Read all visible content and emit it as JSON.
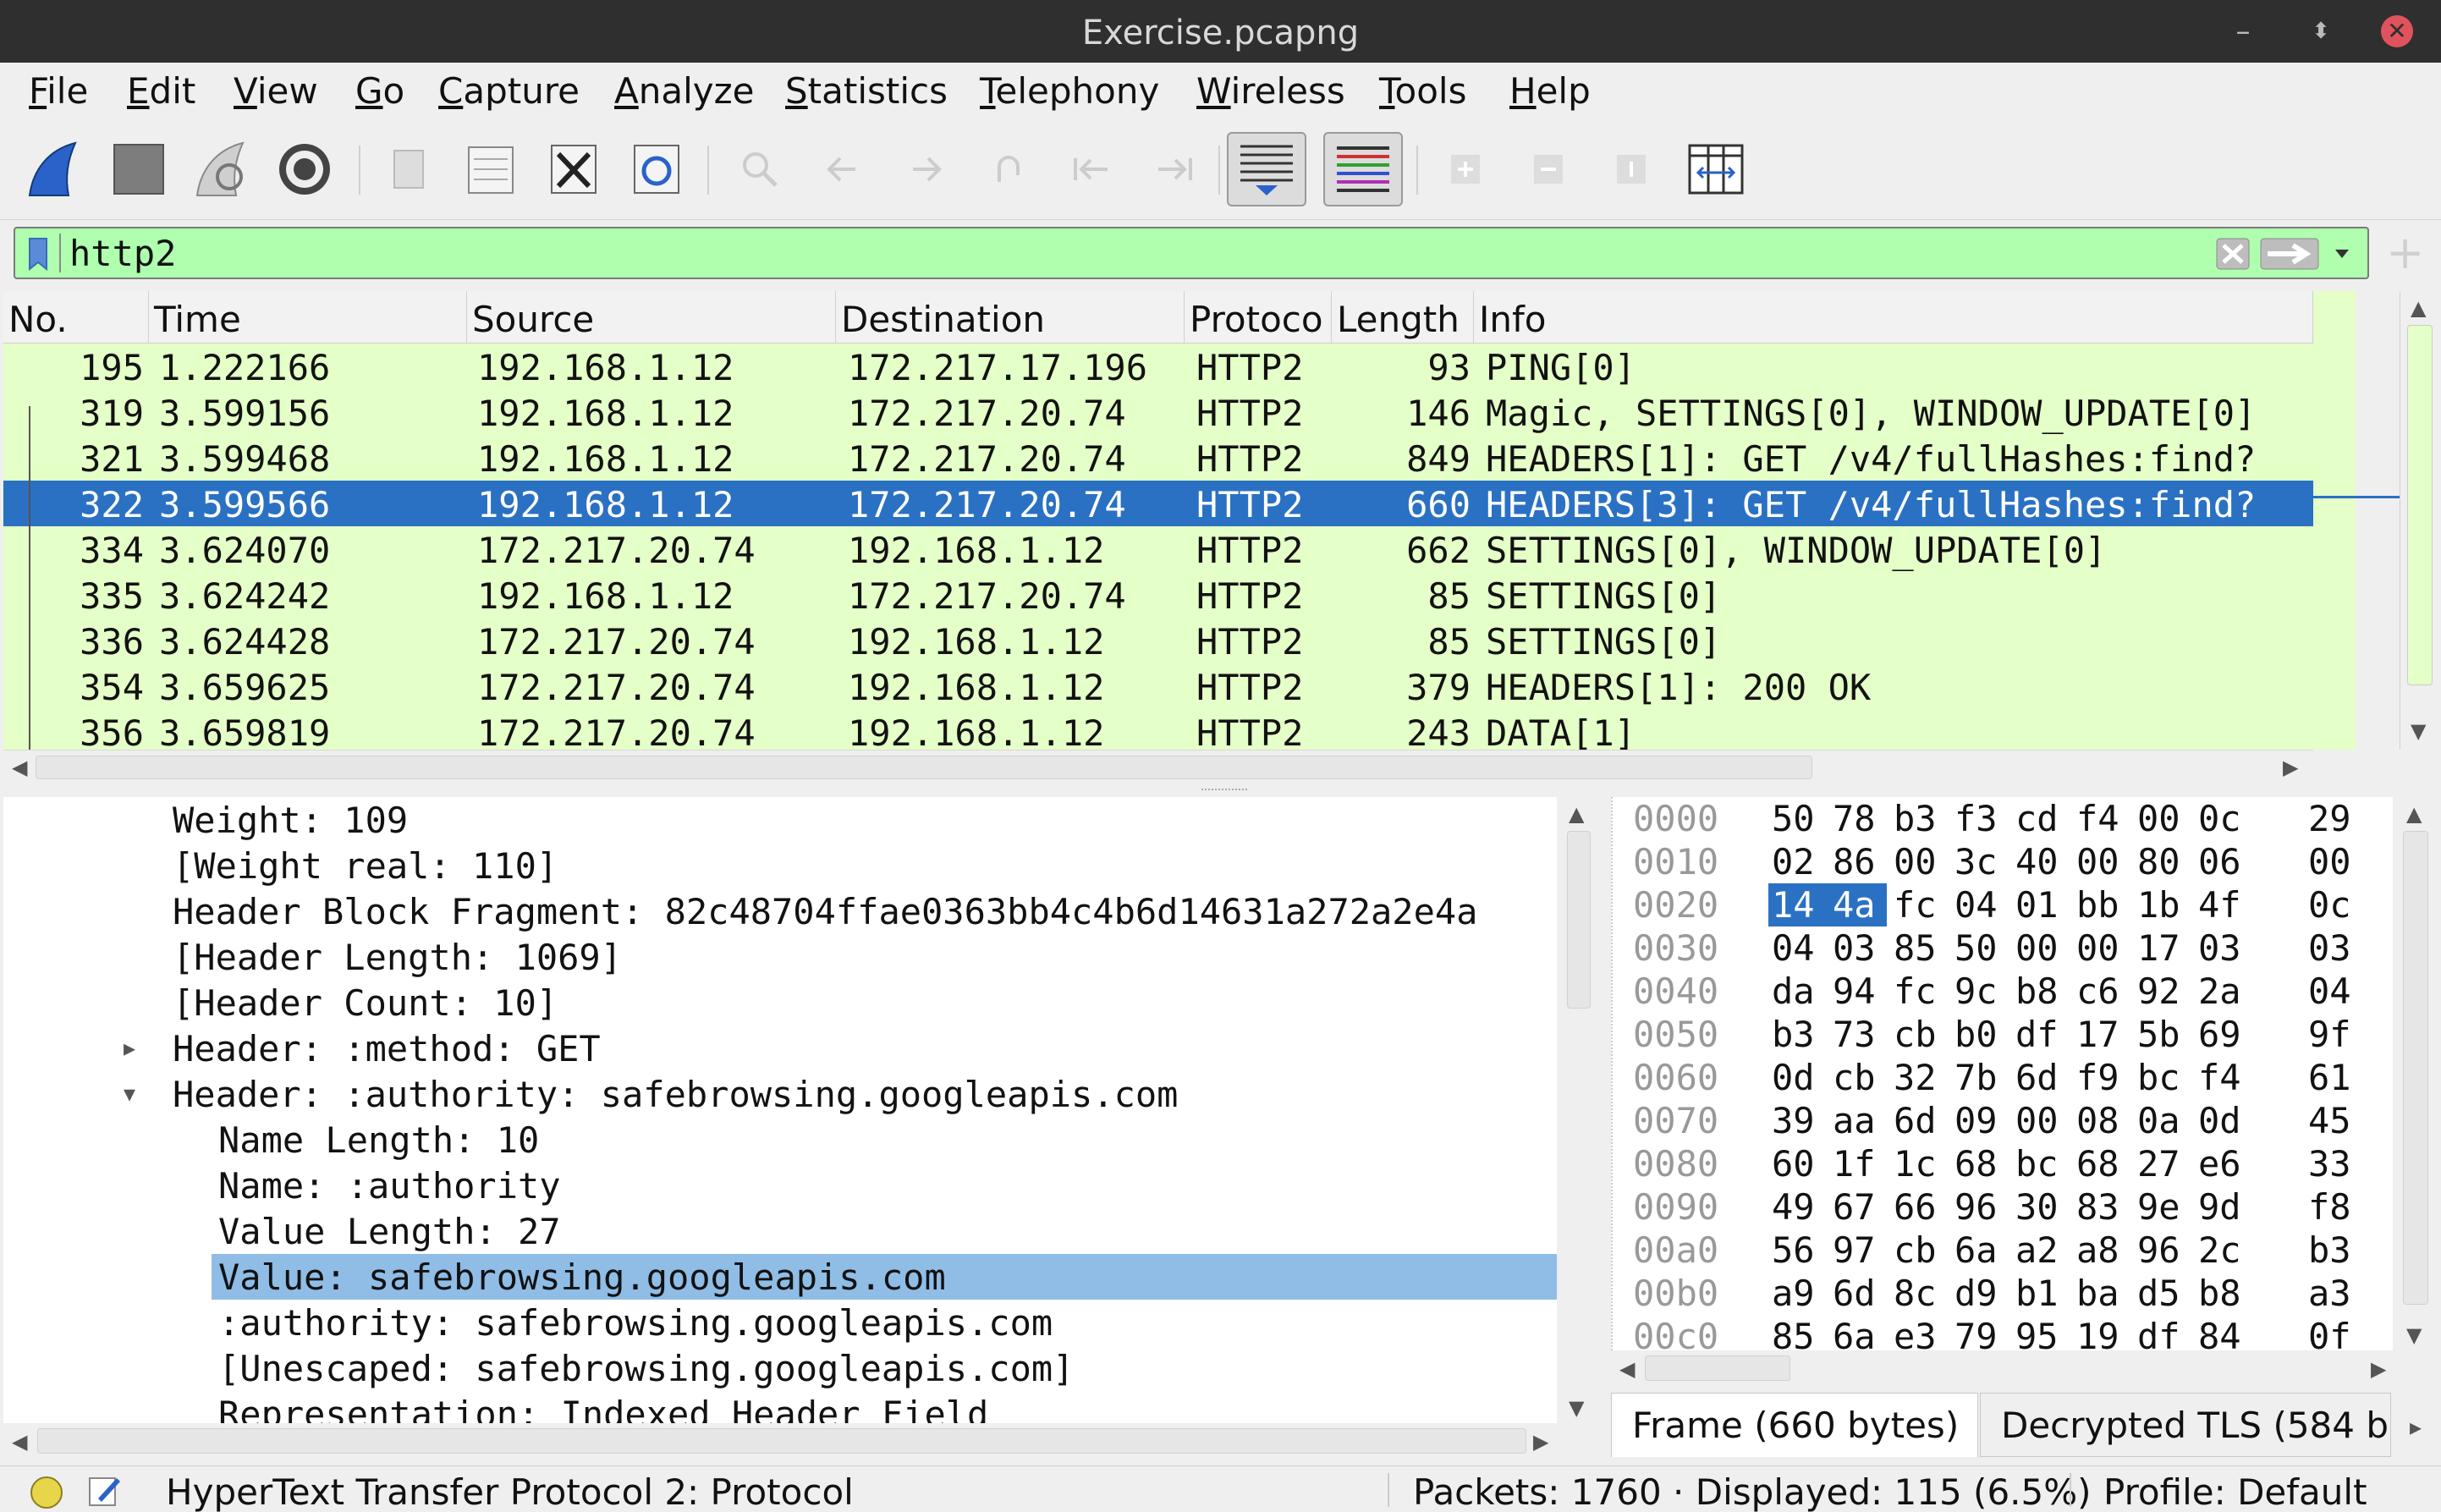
{
  "window": {
    "title": "Exercise.pcapng",
    "close_label": "✕",
    "minimize_label": "–",
    "restore_label": "⬍"
  },
  "menu": [
    "File",
    "Edit",
    "View",
    "Go",
    "Capture",
    "Analyze",
    "Statistics",
    "Telephony",
    "Wireless",
    "Tools",
    "Help"
  ],
  "menu_underline": [
    "F",
    "E",
    "V",
    "G",
    "C",
    "A",
    "S",
    "T",
    "W",
    "T",
    "H"
  ],
  "toolbar": {
    "icons": [
      "shark-fin-start-capture-icon",
      "stop-capture-icon",
      "restart-capture-icon",
      "capture-options-gear-icon",
      "open-file-icon",
      "save-file-icon",
      "close-file-icon",
      "reload-file-icon",
      "find-packet-icon",
      "go-back-icon",
      "go-forward-icon",
      "go-to-packet-icon",
      "go-first-icon",
      "go-last-icon",
      "autoscroll-icon",
      "colorize-icon",
      "zoom-in-icon",
      "zoom-out-icon",
      "normal-size-icon",
      "resize-columns-icon"
    ]
  },
  "filter": {
    "value": "http2"
  },
  "packet_list": {
    "columns": [
      "No.",
      "Time",
      "Source",
      "Destination",
      "Protoco",
      "Length",
      "Info"
    ],
    "rows": [
      {
        "no": "195",
        "time": "1.222166",
        "src": "192.168.1.12",
        "dst": "172.217.17.196",
        "proto": "HTTP2",
        "len": "93",
        "info": "PING[0]"
      },
      {
        "no": "319",
        "time": "3.599156",
        "src": "192.168.1.12",
        "dst": "172.217.20.74",
        "proto": "HTTP2",
        "len": "146",
        "info": "Magic, SETTINGS[0], WINDOW_UPDATE[0]"
      },
      {
        "no": "321",
        "time": "3.599468",
        "src": "192.168.1.12",
        "dst": "172.217.20.74",
        "proto": "HTTP2",
        "len": "849",
        "info": "HEADERS[1]: GET /v4/fullHashes:find?"
      },
      {
        "no": "322",
        "time": "3.599566",
        "src": "192.168.1.12",
        "dst": "172.217.20.74",
        "proto": "HTTP2",
        "len": "660",
        "info": "HEADERS[3]: GET /v4/fullHashes:find?"
      },
      {
        "no": "334",
        "time": "3.624070",
        "src": "172.217.20.74",
        "dst": "192.168.1.12",
        "proto": "HTTP2",
        "len": "662",
        "info": "SETTINGS[0], WINDOW_UPDATE[0]"
      },
      {
        "no": "335",
        "time": "3.624242",
        "src": "192.168.1.12",
        "dst": "172.217.20.74",
        "proto": "HTTP2",
        "len": "85",
        "info": "SETTINGS[0]"
      },
      {
        "no": "336",
        "time": "3.624428",
        "src": "172.217.20.74",
        "dst": "192.168.1.12",
        "proto": "HTTP2",
        "len": "85",
        "info": "SETTINGS[0]"
      },
      {
        "no": "354",
        "time": "3.659625",
        "src": "172.217.20.74",
        "dst": "192.168.1.12",
        "proto": "HTTP2",
        "len": "379",
        "info": "HEADERS[1]: 200 OK"
      },
      {
        "no": "356",
        "time": "3.659819",
        "src": "172.217.20.74",
        "dst": "192.168.1.12",
        "proto": "HTTP2",
        "len": "243",
        "info": "DATA[1]"
      }
    ]
  },
  "details": [
    {
      "text": "Weight: 109",
      "indent": 0
    },
    {
      "text": "[Weight real: 110]",
      "indent": 0
    },
    {
      "text": "Header Block Fragment: 82c48704ffae0363bb4c4b6d14631a272a2e4a",
      "indent": 0
    },
    {
      "text": "[Header Length: 1069]",
      "indent": 0
    },
    {
      "text": "[Header Count: 10]",
      "indent": 0
    },
    {
      "text": "Header: :method: GET",
      "indent": 0,
      "tri": "▸"
    },
    {
      "text": "Header: :authority: safebrowsing.googleapis.com",
      "indent": 0,
      "tri": "▾"
    },
    {
      "text": "Name Length: 10",
      "indent": 1
    },
    {
      "text": "Name: :authority",
      "indent": 1
    },
    {
      "text": "Value Length: 27",
      "indent": 1
    },
    {
      "text": "Value: safebrowsing.googleapis.com",
      "indent": 1,
      "selected": true
    },
    {
      "text": ":authority: safebrowsing.googleapis.com",
      "indent": 1
    },
    {
      "text": "[Unescaped: safebrowsing.googleapis.com]",
      "indent": 1
    },
    {
      "text": "Representation: Indexed Header Field",
      "indent": 1
    }
  ],
  "hex": [
    {
      "offset": "0000",
      "bytes": [
        "50",
        "78",
        "b3",
        "f3",
        "cd",
        "f4",
        "00",
        "0c",
        "29"
      ]
    },
    {
      "offset": "0010",
      "bytes": [
        "02",
        "86",
        "00",
        "3c",
        "40",
        "00",
        "80",
        "06",
        "00"
      ]
    },
    {
      "offset": "0020",
      "bytes": [
        "14",
        "4a",
        "fc",
        "04",
        "01",
        "bb",
        "1b",
        "4f",
        "0c"
      ],
      "highlight": [
        0,
        1
      ]
    },
    {
      "offset": "0030",
      "bytes": [
        "04",
        "03",
        "85",
        "50",
        "00",
        "00",
        "17",
        "03",
        "03"
      ]
    },
    {
      "offset": "0040",
      "bytes": [
        "da",
        "94",
        "fc",
        "9c",
        "b8",
        "c6",
        "92",
        "2a",
        "04"
      ]
    },
    {
      "offset": "0050",
      "bytes": [
        "b3",
        "73",
        "cb",
        "b0",
        "df",
        "17",
        "5b",
        "69",
        "9f"
      ]
    },
    {
      "offset": "0060",
      "bytes": [
        "0d",
        "cb",
        "32",
        "7b",
        "6d",
        "f9",
        "bc",
        "f4",
        "61"
      ]
    },
    {
      "offset": "0070",
      "bytes": [
        "39",
        "aa",
        "6d",
        "09",
        "00",
        "08",
        "0a",
        "0d",
        "45"
      ]
    },
    {
      "offset": "0080",
      "bytes": [
        "60",
        "1f",
        "1c",
        "68",
        "bc",
        "68",
        "27",
        "e6",
        "33"
      ]
    },
    {
      "offset": "0090",
      "bytes": [
        "49",
        "67",
        "66",
        "96",
        "30",
        "83",
        "9e",
        "9d",
        "f8"
      ]
    },
    {
      "offset": "00a0",
      "bytes": [
        "56",
        "97",
        "cb",
        "6a",
        "a2",
        "a8",
        "96",
        "2c",
        "b3"
      ]
    },
    {
      "offset": "00b0",
      "bytes": [
        "a9",
        "6d",
        "8c",
        "d9",
        "b1",
        "ba",
        "d5",
        "b8",
        "a3"
      ]
    },
    {
      "offset": "00c0",
      "bytes": [
        "85",
        "6a",
        "e3",
        "79",
        "95",
        "19",
        "df",
        "84",
        "0f"
      ]
    }
  ],
  "byte_tabs": [
    "Frame (660 bytes)",
    "Decrypted TLS (584 b"
  ],
  "status": {
    "protocol": "HyperText Transfer Protocol 2: Protocol",
    "packets": "Packets: 1760 · Displayed: 115 (6.5%)",
    "profile": "Profile: Default"
  },
  "colors": {
    "list_bg": "#e4ffc7",
    "selected": "#2a71c3",
    "detail_sel": "#8fbde6",
    "filter_ok": "#afffaf"
  }
}
